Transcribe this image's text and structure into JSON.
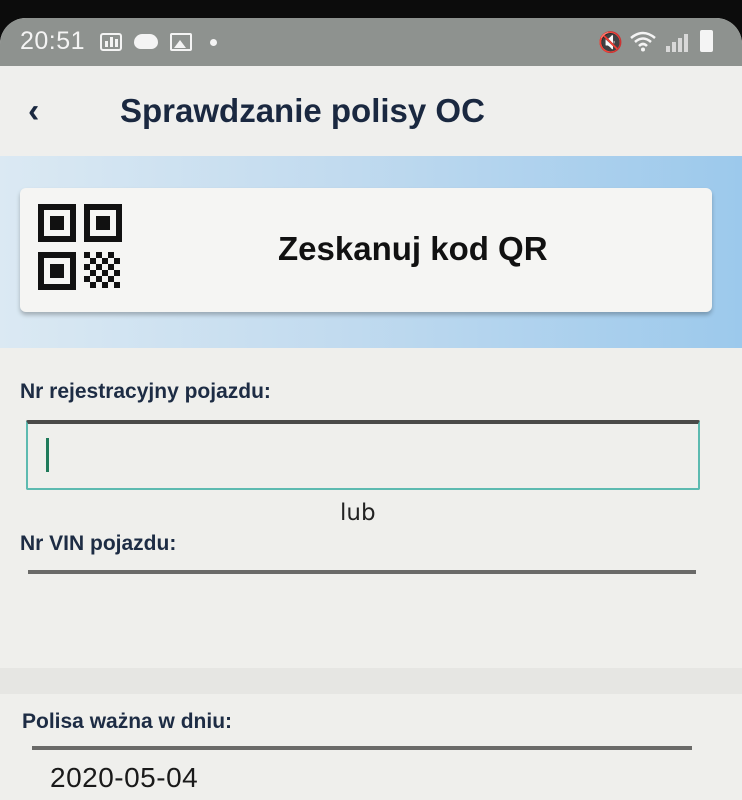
{
  "status_bar": {
    "time": "20:51",
    "icons": [
      "stats-icon",
      "cloud-icon",
      "image-icon",
      "dot-icon",
      "mute-icon",
      "wifi-icon",
      "signal-icon",
      "battery-icon"
    ]
  },
  "header": {
    "back_icon": "chevron-left-icon",
    "back_glyph": "‹",
    "title": "Sprawdzanie polisy OC"
  },
  "qr": {
    "icon": "qr-code-icon",
    "label": "Zeskanuj kod QR"
  },
  "form": {
    "registration": {
      "label": "Nr rejestracyjny pojazdu:",
      "value": ""
    },
    "or_text": "lub",
    "vin": {
      "label": "Nr VIN pojazdu:",
      "value": ""
    },
    "date": {
      "label": "Polisa ważna w dniu:",
      "value": "2020-05-04"
    }
  },
  "colors": {
    "title": "#1a2840",
    "focus_border": "#5dbab0",
    "band_light": "#dbe9f3",
    "band_dark": "#9cc9ec",
    "status_bar": "#8e928f"
  }
}
